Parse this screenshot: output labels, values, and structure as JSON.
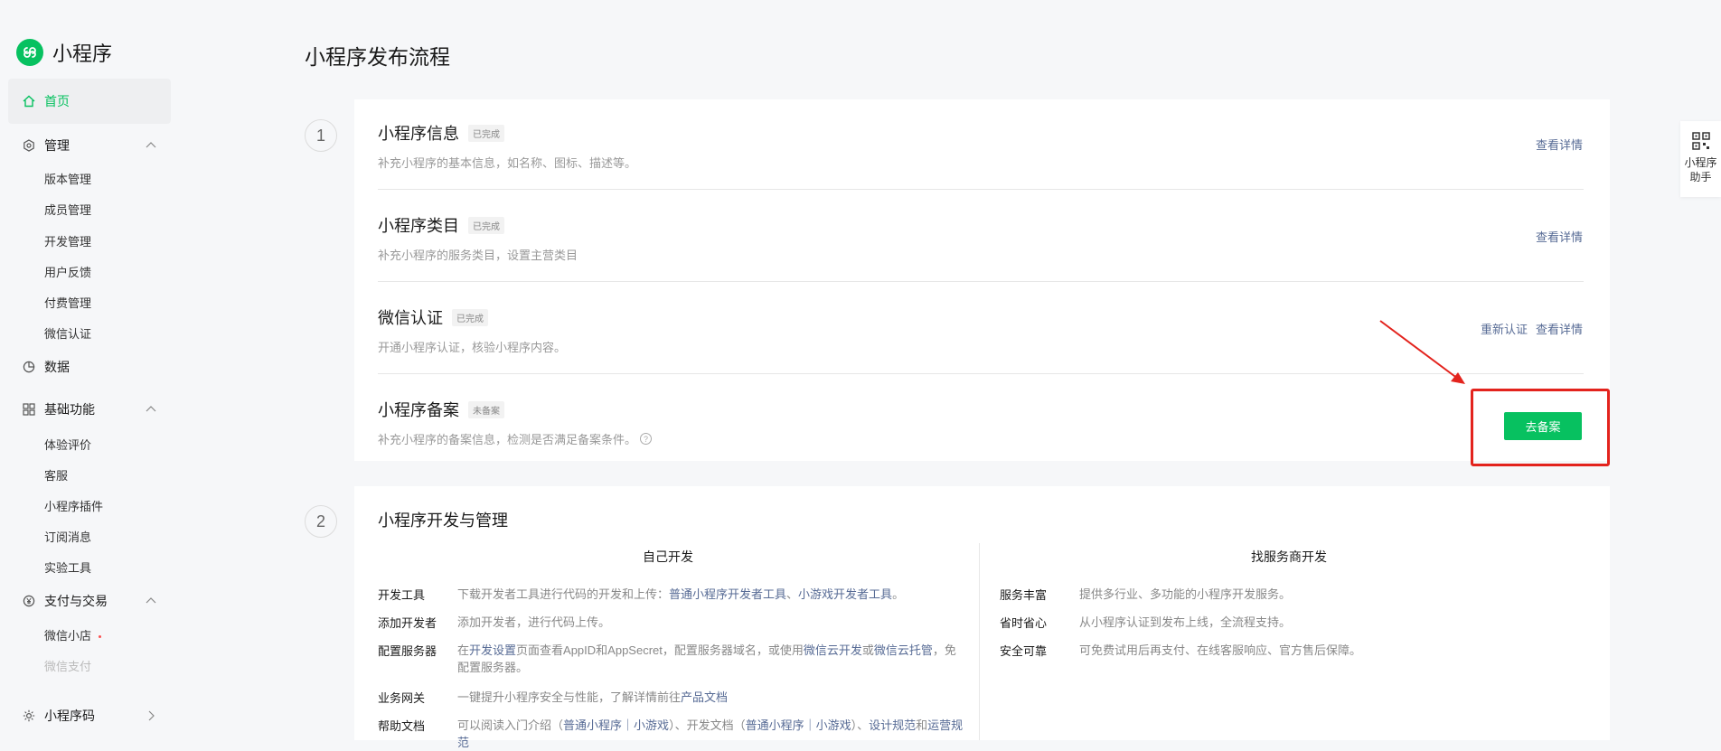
{
  "app": {
    "logo_text": "小程序",
    "colors": {
      "brand": "#07c160",
      "link": "#576b95",
      "highlight": "#e3231d"
    }
  },
  "sidebar": {
    "home": {
      "label": "首页",
      "icon": "home-icon"
    },
    "groups": [
      {
        "label": "管理",
        "icon": "settings-icon",
        "items": [
          "版本管理",
          "成员管理",
          "开发管理",
          "用户反馈",
          "付费管理",
          "微信认证"
        ]
      },
      {
        "label": "数据",
        "icon": "pie-chart-icon"
      },
      {
        "label": "基础功能",
        "icon": "grid-icon",
        "items": [
          "体验评价",
          "客服",
          "小程序插件",
          "订阅消息",
          "实验工具"
        ]
      },
      {
        "label": "支付与交易",
        "icon": "yen-icon",
        "items": [
          "微信小店",
          "微信支付"
        ]
      },
      {
        "label": "小程序码",
        "icon": "sun-icon"
      }
    ]
  },
  "main": {
    "page_title": "小程序发布流程",
    "step1": {
      "number": "1",
      "rows": [
        {
          "title": "小程序信息",
          "tag": "已完成",
          "desc": "补充小程序的基本信息，如名称、图标、描述等。",
          "links": [
            "查看详情"
          ]
        },
        {
          "title": "小程序类目",
          "tag": "已完成",
          "desc": "补充小程序的服务类目，设置主营类目",
          "links": [
            "查看详情"
          ]
        },
        {
          "title": "微信认证",
          "tag": "已完成",
          "desc": "开通小程序认证，核验小程序内容。",
          "links": [
            "重新认证",
            "查看详情"
          ]
        },
        {
          "title": "小程序备案",
          "tag": "未备案",
          "desc": "补充小程序的备案信息，检测是否满足备案条件。",
          "button": "去备案"
        }
      ]
    },
    "step2": {
      "number": "2",
      "title": "小程序开发与管理",
      "left": {
        "heading": "自己开发",
        "items": [
          {
            "key": "开发工具",
            "text": "下载开发者工具进行代码的开发和上传：",
            "link1": "普通小程序开发者工具",
            "sep": "、",
            "link2": "小游戏开发者工具",
            "end": "。"
          },
          {
            "key": "添加开发者",
            "text": "添加开发者，进行代码上传。"
          },
          {
            "key": "配置服务器",
            "t1": "在",
            "l1": "开发设置",
            "t2": "页面查看AppID和AppSecret，配置服务器域名，或使用",
            "l2": "微信云开发",
            "t3": "或",
            "l3": "微信云托管",
            "t4": "，免配置服务器。"
          },
          {
            "key": "业务网关",
            "text": "一键提升小程序安全与性能，了解详情前往",
            "link": "产品文档"
          },
          {
            "key": "帮助文档",
            "t1": "可以阅读入门介绍（",
            "l1": "普通小程序",
            "s1": "｜",
            "l2": "小游戏",
            "t2": "）、开发文档（",
            "l3": "普通小程序",
            "s2": "｜",
            "l4": "小游戏",
            "t3": "）、",
            "l5": "设计规范",
            "t4": "和",
            "l6": "运营规范"
          }
        ]
      },
      "right": {
        "heading": "找服务商开发",
        "items": [
          {
            "key": "服务丰富",
            "text": "提供多行业、多功能的小程序开发服务。"
          },
          {
            "key": "省时省心",
            "text": "从小程序认证到发布上线，全流程支持。"
          },
          {
            "key": "安全可靠",
            "text": "可免费试用后再支付、在线客服响应、官方售后保障。"
          }
        ]
      }
    }
  },
  "helper": {
    "label_line1": "小程序",
    "label_line2": "助手",
    "icon": "qr-code-icon"
  }
}
